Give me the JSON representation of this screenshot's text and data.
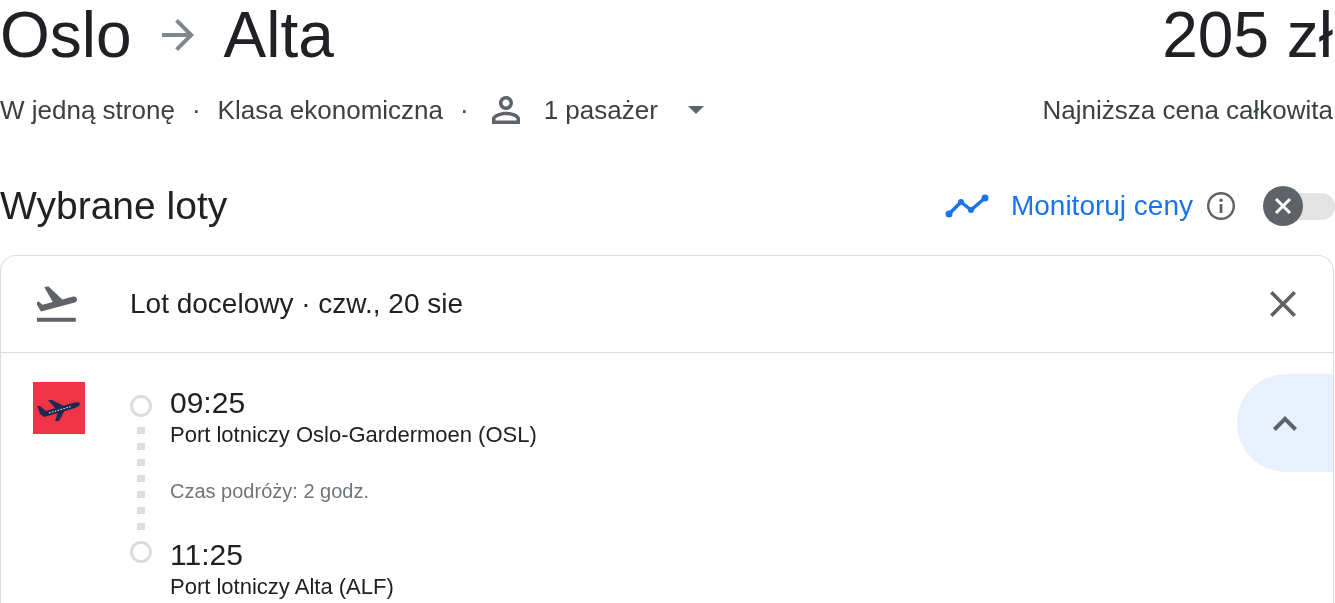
{
  "route": {
    "origin": "Oslo",
    "destination": "Alta"
  },
  "price": {
    "amount": "205 zł",
    "note": "Najniższa cena całkowita"
  },
  "summary": [
    {
      "kind": "text",
      "text": "W jedną stronę"
    },
    {
      "kind": "separator",
      "text": "·"
    },
    {
      "kind": "text",
      "text": "Klasa ekonomiczna"
    },
    {
      "kind": "separator",
      "text": "·"
    },
    {
      "kind": "passengers",
      "text": "1 pasażer"
    }
  ],
  "selected_flights": {
    "title": "Wybrane loty",
    "price_tracking": {
      "label": "Monitoruj ceny",
      "on": false
    }
  },
  "flight_card": {
    "title": "Lot docelowy · czw., 20 sie",
    "expanded": true,
    "stops": [
      {
        "time": "09:25",
        "airport": "Port lotniczy Oslo-Gardermoen (OSL)"
      },
      {
        "time": "11:25",
        "airport": "Port lotniczy Alta (ALF)"
      }
    ],
    "duration": "Czas podróży: 2 godz."
  }
}
